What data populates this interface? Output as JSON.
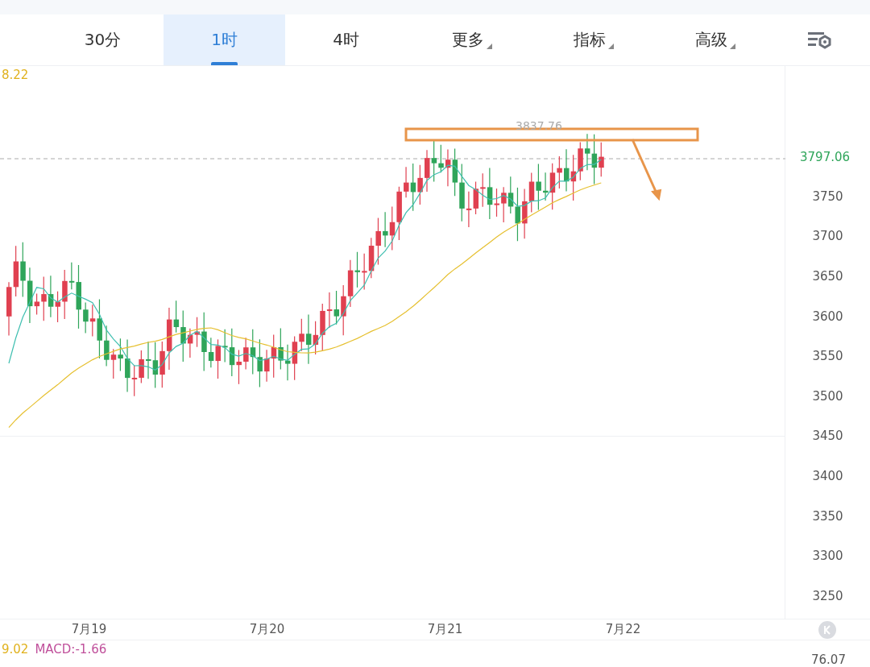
{
  "tabs": [
    {
      "label": "30分",
      "selected": false,
      "dropdown": false
    },
    {
      "label": "1时",
      "selected": true,
      "dropdown": false
    },
    {
      "label": "4时",
      "selected": false,
      "dropdown": false
    },
    {
      "label": "更多",
      "selected": false,
      "dropdown": true
    },
    {
      "label": "指标",
      "selected": false,
      "dropdown": true
    },
    {
      "label": "高级",
      "selected": false,
      "dropdown": true
    }
  ],
  "chart": {
    "max_label": "8.22",
    "high_label": "3837.76",
    "current_price": "3797.06",
    "y_axis": [
      "3750",
      "3700",
      "3650",
      "3600",
      "3550",
      "3500",
      "3450",
      "3400",
      "3350",
      "3300",
      "3250"
    ],
    "x_axis": [
      "7月19",
      "7月20",
      "7月21",
      "7月22"
    ]
  },
  "indicator": {
    "value": "9.02",
    "macd": "MACD:-1.66",
    "axis_label": "76.07"
  }
}
